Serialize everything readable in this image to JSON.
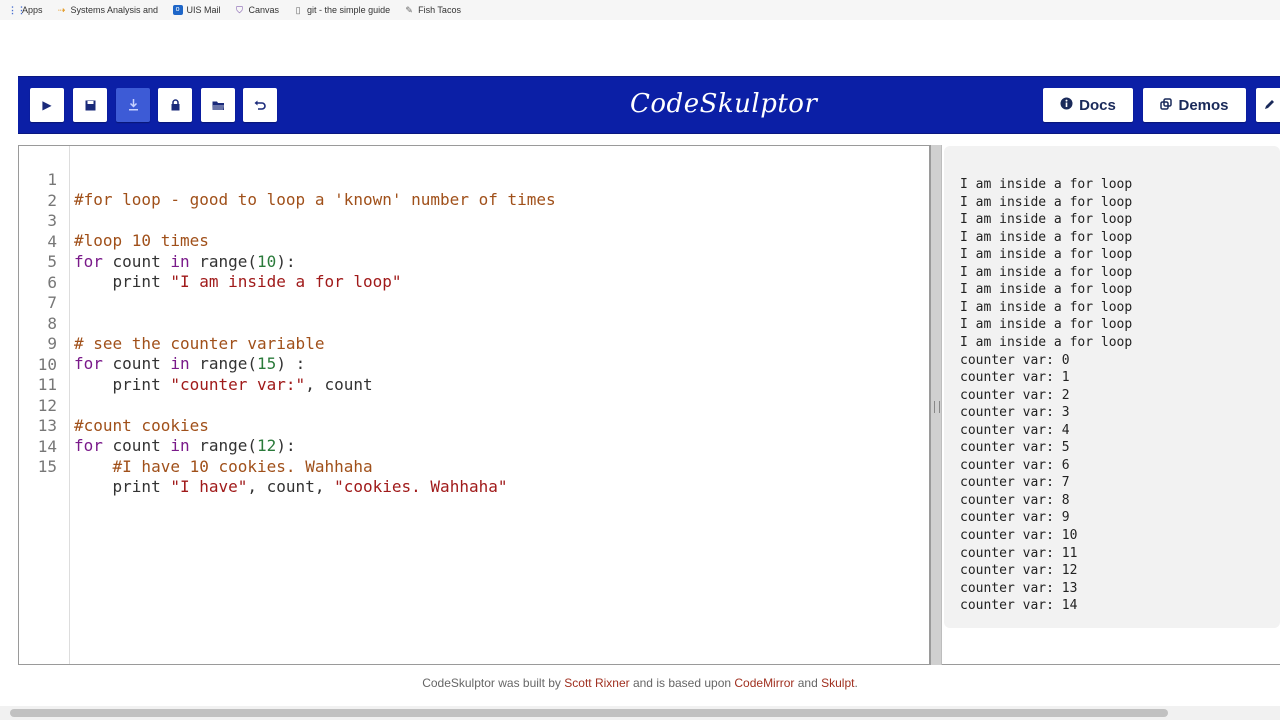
{
  "bookmarks": [
    {
      "label": "Apps",
      "icon": "apps-grid-icon"
    },
    {
      "label": "Systems Analysis and De",
      "icon": "arrow-icon"
    },
    {
      "label": "UIS Mail",
      "icon": "outlook-icon"
    },
    {
      "label": "Canvas",
      "icon": "shield-icon"
    },
    {
      "label": "git - the simple guide",
      "icon": "document-icon"
    },
    {
      "label": "Fish Tacos",
      "icon": "pen-icon"
    }
  ],
  "header": {
    "brand": "CodeSkulptor",
    "toolbar": [
      {
        "name": "run",
        "icon": "play-icon",
        "glyph": "▶"
      },
      {
        "name": "save",
        "icon": "save-icon",
        "glyph": "■"
      },
      {
        "name": "download",
        "icon": "download-icon",
        "glyph": "⤓"
      },
      {
        "name": "fresh-url",
        "icon": "lock-icon",
        "glyph": "🔒"
      },
      {
        "name": "open",
        "icon": "folder-icon",
        "glyph": "▰"
      },
      {
        "name": "reset",
        "icon": "undo-icon",
        "glyph": "↶"
      }
    ],
    "docs_label": "Docs",
    "demos_label": "Demos"
  },
  "editor": {
    "line_numbers": [
      "1",
      "2",
      "3",
      "4",
      "5",
      "6",
      "7",
      "8",
      "9",
      "10",
      "11",
      "12",
      "13",
      "14",
      "15"
    ]
  },
  "output": {
    "lines": [
      "I am inside a for loop",
      "I am inside a for loop",
      "I am inside a for loop",
      "I am inside a for loop",
      "I am inside a for loop",
      "I am inside a for loop",
      "I am inside a for loop",
      "I am inside a for loop",
      "I am inside a for loop",
      "I am inside a for loop",
      "counter var: 0",
      "counter var: 1",
      "counter var: 2",
      "counter var: 3",
      "counter var: 4",
      "counter var: 5",
      "counter var: 6",
      "counter var: 7",
      "counter var: 8",
      "counter var: 9",
      "counter var: 10",
      "counter var: 11",
      "counter var: 12",
      "counter var: 13",
      "counter var: 14"
    ]
  },
  "footer": {
    "prefix": "CodeSkulptor was built by ",
    "author": "Scott Rixner",
    "middle": " and is based upon ",
    "lib1": "CodeMirror",
    "and": " and ",
    "lib2": "Skulpt",
    "suffix": "."
  },
  "code": {
    "l1": "#for loop - good to loop a 'known' number of times",
    "l3": "#loop 10 times",
    "l4_kw1": "for",
    "l4_a": " count ",
    "l4_kw2": "in",
    "l4_b": " range(",
    "l4_num": "10",
    "l4_c": "):",
    "l5_a": "    print ",
    "l5_str": "\"I am inside a for loop\"",
    "l8": "# see the counter variable",
    "l9_kw1": "for",
    "l9_a": " count ",
    "l9_kw2": "in",
    "l9_b": " range(",
    "l9_num": "15",
    "l9_c": ") :",
    "l10_a": "    print ",
    "l10_str": "\"counter var:\"",
    "l10_b": ", count",
    "l12": "#count cookies",
    "l13_kw1": "for",
    "l13_a": " count ",
    "l13_kw2": "in",
    "l13_b": " range(",
    "l13_num": "12",
    "l13_c": "):",
    "l14_a": "    ",
    "l14_cm": "#I have 10 cookies. Wahhaha",
    "l15_a": "    print ",
    "l15_str1": "\"I have\"",
    "l15_b": ", count, ",
    "l15_str2": "\"cookies. Wahhaha\""
  },
  "colors": {
    "header_bg": "#0b1fa6",
    "comment": "#a0501a",
    "keyword": "#7a1a8a",
    "number": "#2a7a3a",
    "string": "#a01a1a",
    "link": "#a03020"
  }
}
